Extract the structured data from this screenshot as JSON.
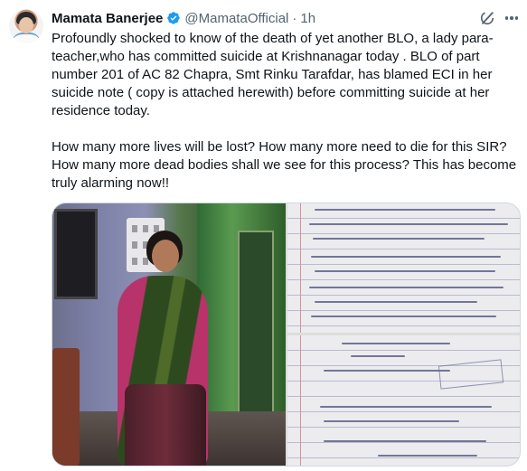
{
  "tweet": {
    "author_name": "Mamata Banerjee",
    "author_handle": "@MamataOfficial",
    "separator": "·",
    "time": "1h",
    "verified": true,
    "body": [
      "Profoundly shocked to know of the death of yet another BLO, a lady para-teacher,who has  committed suicide at Krishnanagar today . BLO of part number 201 of AC 82 Chapra, Smt Rinku Tarafdar, has blamed ECI in her suicide note ( copy is attached herewith) before committing suicide at her residence today.",
      "How many more lives will be lost? How many more need to die for this SIR? How many more dead bodies shall we see for this process? This has become truly alarming now!!"
    ],
    "icons": {
      "verified": "verified-badge-icon",
      "grok": "grok-icon",
      "more": "more-icon"
    },
    "colors": {
      "text": "#0f1419",
      "secondary": "#536471",
      "verified": "#1d9bf0"
    }
  }
}
